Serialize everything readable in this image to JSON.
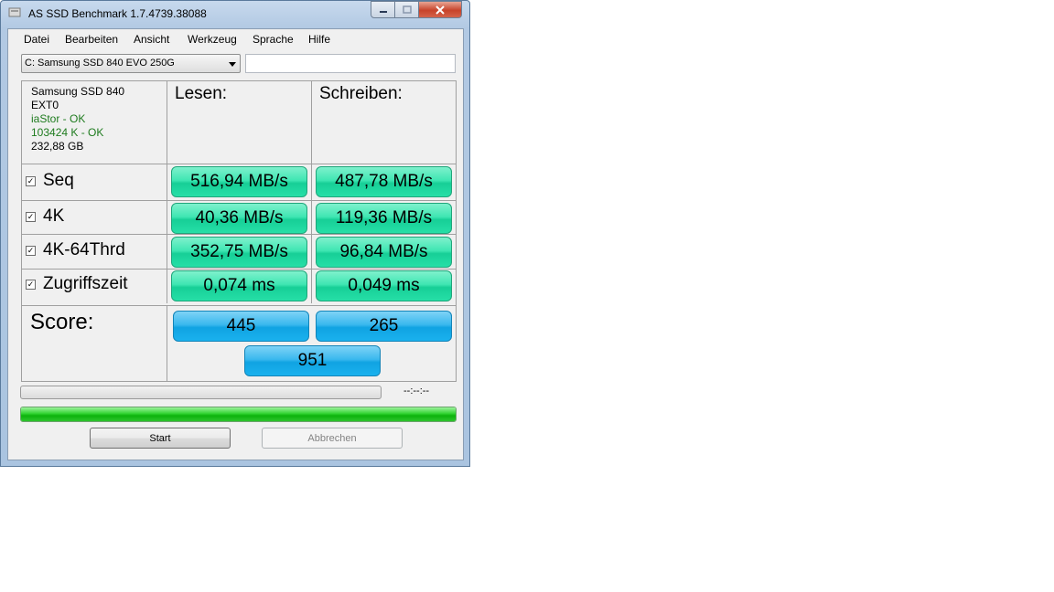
{
  "window": {
    "title": "AS SSD Benchmark 1.7.4739.38088"
  },
  "menu": [
    "Datei",
    "Bearbeiten",
    "Ansicht",
    "Werkzeug",
    "Sprache",
    "Hilfe"
  ],
  "drive_select": {
    "value": "C: Samsung SSD 840 EVO 250G"
  },
  "info": {
    "model": "Samsung SSD 840",
    "firmware": "EXT0",
    "driver": "iaStor - OK",
    "alignment": "103424 K - OK",
    "size": "232,88 GB"
  },
  "columns": {
    "read": "Lesen:",
    "write": "Schreiben:"
  },
  "rows": [
    {
      "label": "Seq",
      "read": "516,94 MB/s",
      "write": "487,78 MB/s"
    },
    {
      "label": "4K",
      "read": "40,36 MB/s",
      "write": "119,36 MB/s"
    },
    {
      "label": "4K-64Thrd",
      "read": "352,75 MB/s",
      "write": "96,84 MB/s"
    },
    {
      "label": "Zugriffszeit",
      "read": "0,074 ms",
      "write": "0,049 ms"
    }
  ],
  "score": {
    "label": "Score:",
    "read": "445",
    "write": "265",
    "total": "951"
  },
  "progress": {
    "timer": "--:--:--",
    "main_fraction": 1.0
  },
  "buttons": {
    "start": "Start",
    "abort": "Abbrechen"
  },
  "colors": {
    "result_pill": "#2de0a8",
    "score_pill": "#21aee9",
    "progress_fill": "#1fc21f"
  }
}
